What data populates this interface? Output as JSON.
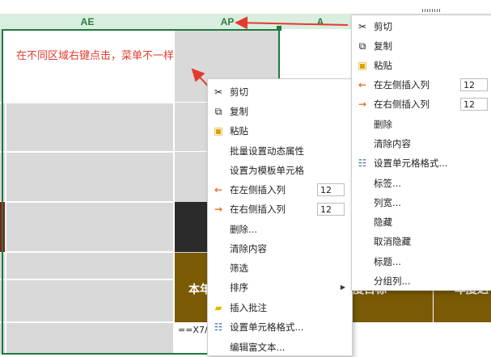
{
  "columns": {
    "ae": "AE",
    "ap": "AP",
    "next": "A"
  },
  "annotation": "在不同区域右键点击，菜单不一样",
  "cells": {
    "brown_left": "本年",
    "brown_mid": "度目标",
    "brown_right": "年度达",
    "formula": "==X7/"
  },
  "menu_left": {
    "items": [
      {
        "label": "剪切",
        "icon": "scissors-icon"
      },
      {
        "label": "复制",
        "icon": "copy-icon"
      },
      {
        "label": "粘贴",
        "icon": "paste-icon"
      },
      {
        "label": "批量设置动态属性"
      },
      {
        "label": "设置为模板单元格"
      },
      {
        "label": "在左侧插入列",
        "icon": "arrow-left-icon",
        "value": "12"
      },
      {
        "label": "在右侧插入列",
        "icon": "arrow-right-icon",
        "value": "12"
      },
      {
        "label": "删除..."
      },
      {
        "label": "清除内容"
      },
      {
        "label": "筛选"
      },
      {
        "label": "排序",
        "submenu": true
      },
      {
        "label": "插入批注",
        "icon": "note-icon"
      },
      {
        "label": "设置单元格格式...",
        "icon": "format-cells-icon"
      },
      {
        "label": "编辑富文本..."
      }
    ]
  },
  "menu_right": {
    "items": [
      {
        "label": "剪切",
        "icon": "scissors-icon"
      },
      {
        "label": "复制",
        "icon": "copy-icon"
      },
      {
        "label": "粘贴",
        "icon": "paste-icon"
      },
      {
        "label": "在左侧插入列",
        "icon": "arrow-left-icon",
        "value": "12"
      },
      {
        "label": "在右侧插入列",
        "icon": "arrow-right-icon",
        "value": "12"
      },
      {
        "label": "删除"
      },
      {
        "label": "清除内容"
      },
      {
        "label": "设置单元格格式...",
        "icon": "format-cells-icon"
      },
      {
        "label": "标签..."
      },
      {
        "label": "列宽..."
      },
      {
        "label": "隐藏"
      },
      {
        "label": "取消隐藏"
      },
      {
        "label": "标题..."
      },
      {
        "label": "分组列..."
      }
    ]
  },
  "colors": {
    "annotation": "#e53a2f",
    "header_bg": "#d9eedf",
    "selection": "#1f7a3d",
    "orange_arrow": "#e8702a"
  }
}
